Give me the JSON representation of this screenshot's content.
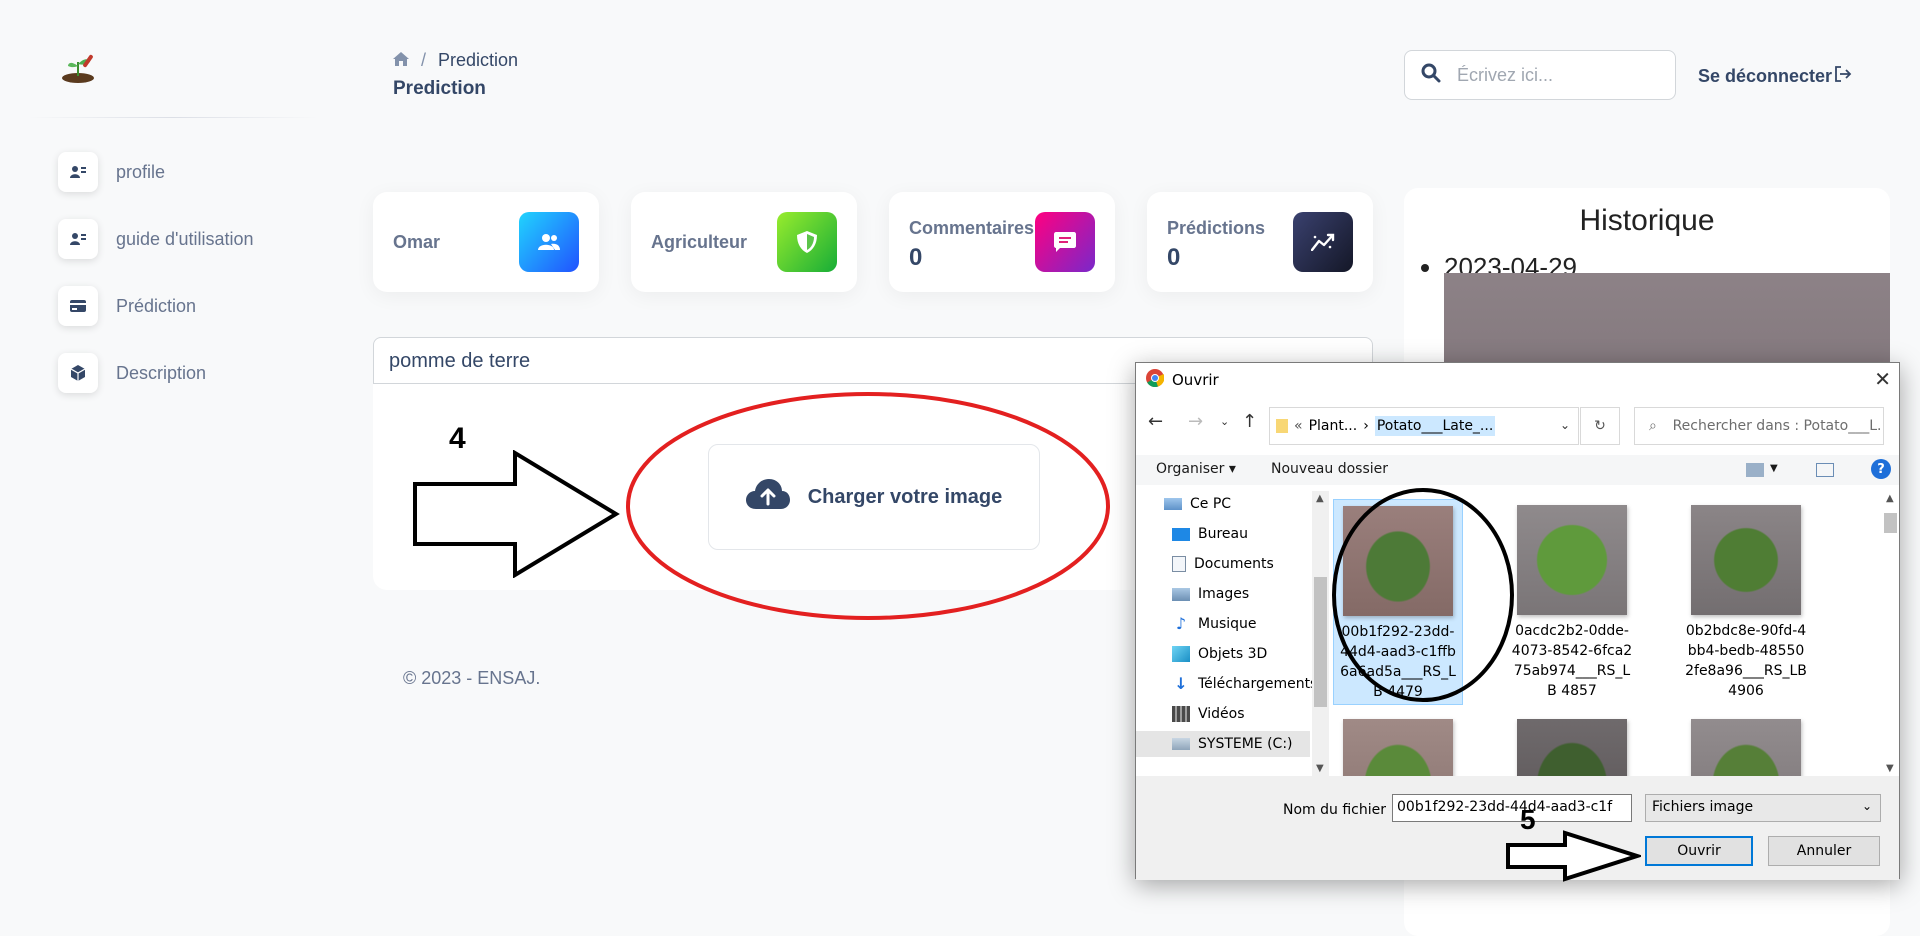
{
  "breadcrumb": {
    "current": "Prediction"
  },
  "page_title": "Prediction",
  "search": {
    "placeholder": "Écrivez ici..."
  },
  "logout_label": "Se déconnecter",
  "sidebar": {
    "items": [
      {
        "label": "profile",
        "icon": "user-card-icon"
      },
      {
        "label": "guide d'utilisation",
        "icon": "user-card-icon"
      },
      {
        "label": "Prédiction",
        "icon": "credit-card-icon"
      },
      {
        "label": "Description",
        "icon": "box-icon"
      }
    ]
  },
  "cards": [
    {
      "title": "Omar",
      "icon": "users-icon",
      "color_from": "#21d4fd",
      "color_to": "#2152ff"
    },
    {
      "title": "Agriculteur",
      "icon": "shield-icon",
      "color_from": "#98ec2d",
      "color_to": "#17ad37"
    },
    {
      "title": "Commentaires",
      "value": "0",
      "icon": "comment-icon",
      "color_from": "#ff0080",
      "color_to": "#7928ca"
    },
    {
      "title": "Prédictions",
      "value": "0",
      "icon": "chart-icon",
      "color_from": "#3a416f",
      "color_to": "#141727"
    }
  ],
  "history": {
    "title": "Historique",
    "entries": [
      "2023-04-29"
    ]
  },
  "plant_select": {
    "value": "pomme de terre"
  },
  "upload": {
    "label": "Charger votre image"
  },
  "annotations": {
    "step4": "4",
    "step5": "5"
  },
  "footer": "© 2023  - ENSAJ.",
  "dialog": {
    "title": "Ouvrir",
    "address": {
      "parent": "Plant...",
      "current": "Potato___Late_..."
    },
    "search_placeholder": "Rechercher dans : Potato___L...",
    "toolbar": {
      "organize": "Organiser ▾",
      "new_folder": "Nouveau dossier"
    },
    "tree": [
      "Ce PC",
      "Bureau",
      "Documents",
      "Images",
      "Musique",
      "Objets 3D",
      "Téléchargements",
      "Vidéos",
      "SYSTEME (C:)"
    ],
    "files": [
      "00b1f292-23dd-44d4-aad3-c1ffb6a6ad5a___RS_LB 4479",
      "0acdc2b2-0dde-4073-8542-6fca275ab974___RS_LB 4857",
      "0b2bdc8e-90fd-4bb4-bedb-485502fe8a96___RS_LB 4906"
    ],
    "filename_label": "Nom du fichier :",
    "filename_value": "00b1f292-23dd-44d4-aad3-c1f",
    "filetype": "Fichiers image",
    "open_button": "Ouvrir",
    "cancel_button": "Annuler"
  }
}
